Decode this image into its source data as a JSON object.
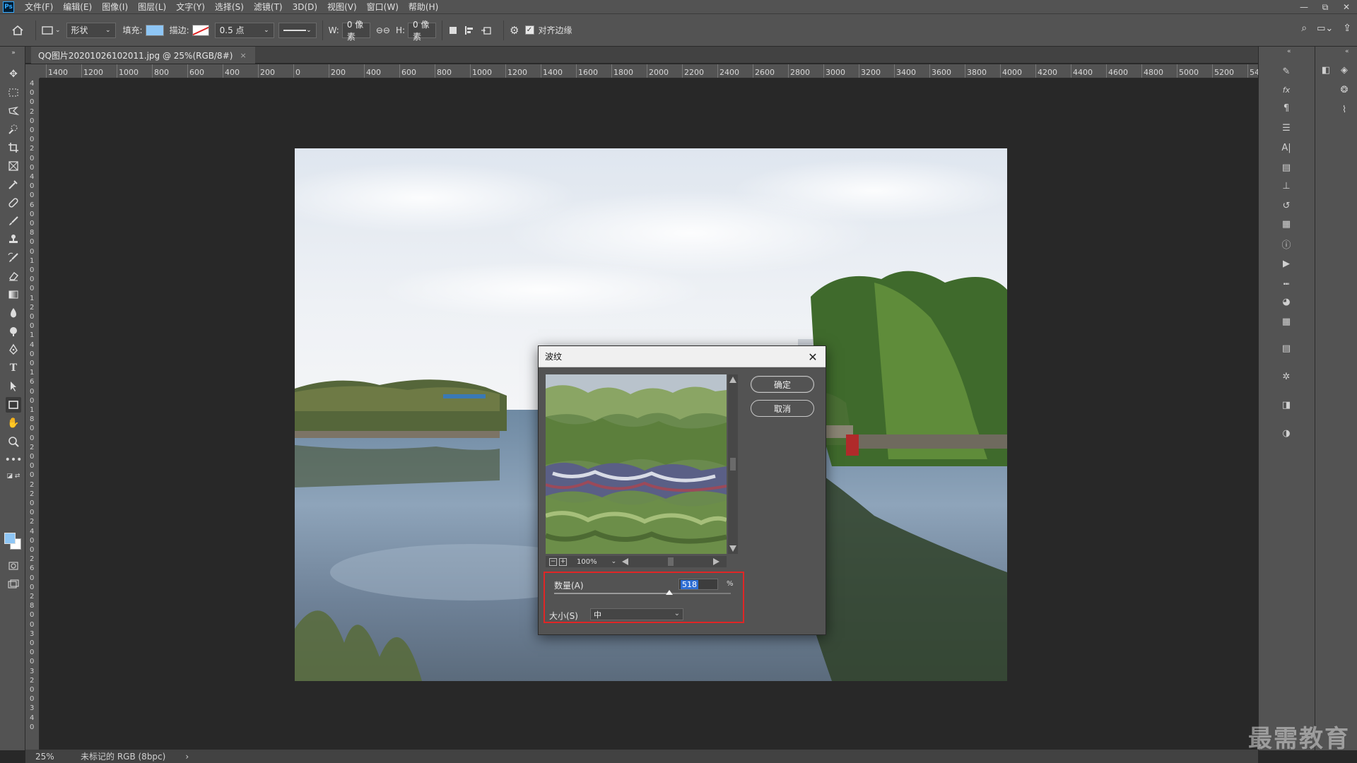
{
  "app": {
    "logo": "Ps"
  },
  "menu": [
    "文件(F)",
    "编辑(E)",
    "图像(I)",
    "图层(L)",
    "文字(Y)",
    "选择(S)",
    "滤镜(T)",
    "3D(D)",
    "视图(V)",
    "窗口(W)",
    "帮助(H)"
  ],
  "window_controls": {
    "minimize": "—",
    "restore": "⧉",
    "close": "✕"
  },
  "options": {
    "mode": "形状",
    "fill_label": "填充:",
    "stroke_label": "描边:",
    "stroke_width": "0.5 点",
    "w_label": "W:",
    "w_value": "0 像素",
    "h_label": "H:",
    "h_value": "0 像素",
    "align_edges_label": "对齐边缘",
    "align_edges_checked": true,
    "fill_color": "#8ec6f5"
  },
  "document": {
    "tab_title": "QQ图片20201026102011.jpg @ 25%(RGB/8#)",
    "close_glyph": "×"
  },
  "ruler": {
    "h_labels": [
      "1400",
      "1200",
      "1000",
      "800",
      "600",
      "400",
      "200",
      "0",
      "200",
      "400",
      "600",
      "800",
      "1000",
      "1200",
      "1400",
      "1600",
      "1800",
      "2000",
      "2200",
      "2400",
      "2600",
      "2800",
      "3000",
      "3200",
      "3400",
      "3600",
      "3800",
      "4000",
      "4200",
      "4400",
      "4600",
      "4800",
      "5000",
      "5200",
      "54"
    ],
    "v_labels": [
      "4",
      "0",
      "0",
      "2",
      "0",
      "0",
      "0",
      "2",
      "0",
      "0",
      "4",
      "0",
      "0",
      "6",
      "0",
      "0",
      "8",
      "0",
      "0",
      "1",
      "0",
      "0",
      "0",
      "1",
      "2",
      "0",
      "0",
      "1",
      "4",
      "0",
      "0",
      "1",
      "6",
      "0",
      "0",
      "1",
      "8",
      "0",
      "0",
      "2",
      "0",
      "0",
      "0",
      "2",
      "2",
      "0",
      "0",
      "2",
      "4",
      "0",
      "0",
      "2",
      "6",
      "0",
      "0",
      "2",
      "8",
      "0",
      "0",
      "3",
      "0",
      "0",
      "0",
      "3",
      "2",
      "0",
      "0",
      "3",
      "4",
      "0"
    ]
  },
  "dialog": {
    "title": "波纹",
    "ok_label": "确定",
    "cancel_label": "取消",
    "zoom_level": "100%",
    "amount_label": "数量(A)",
    "amount_value": "518",
    "amount_unit": "%",
    "amount_fraction": 0.65,
    "size_label": "大小(S)",
    "size_value": "中"
  },
  "status": {
    "zoom": "25%",
    "info": "未标记的 RGB (8bpc)",
    "arrow": "›"
  },
  "watermark": "最需教育"
}
